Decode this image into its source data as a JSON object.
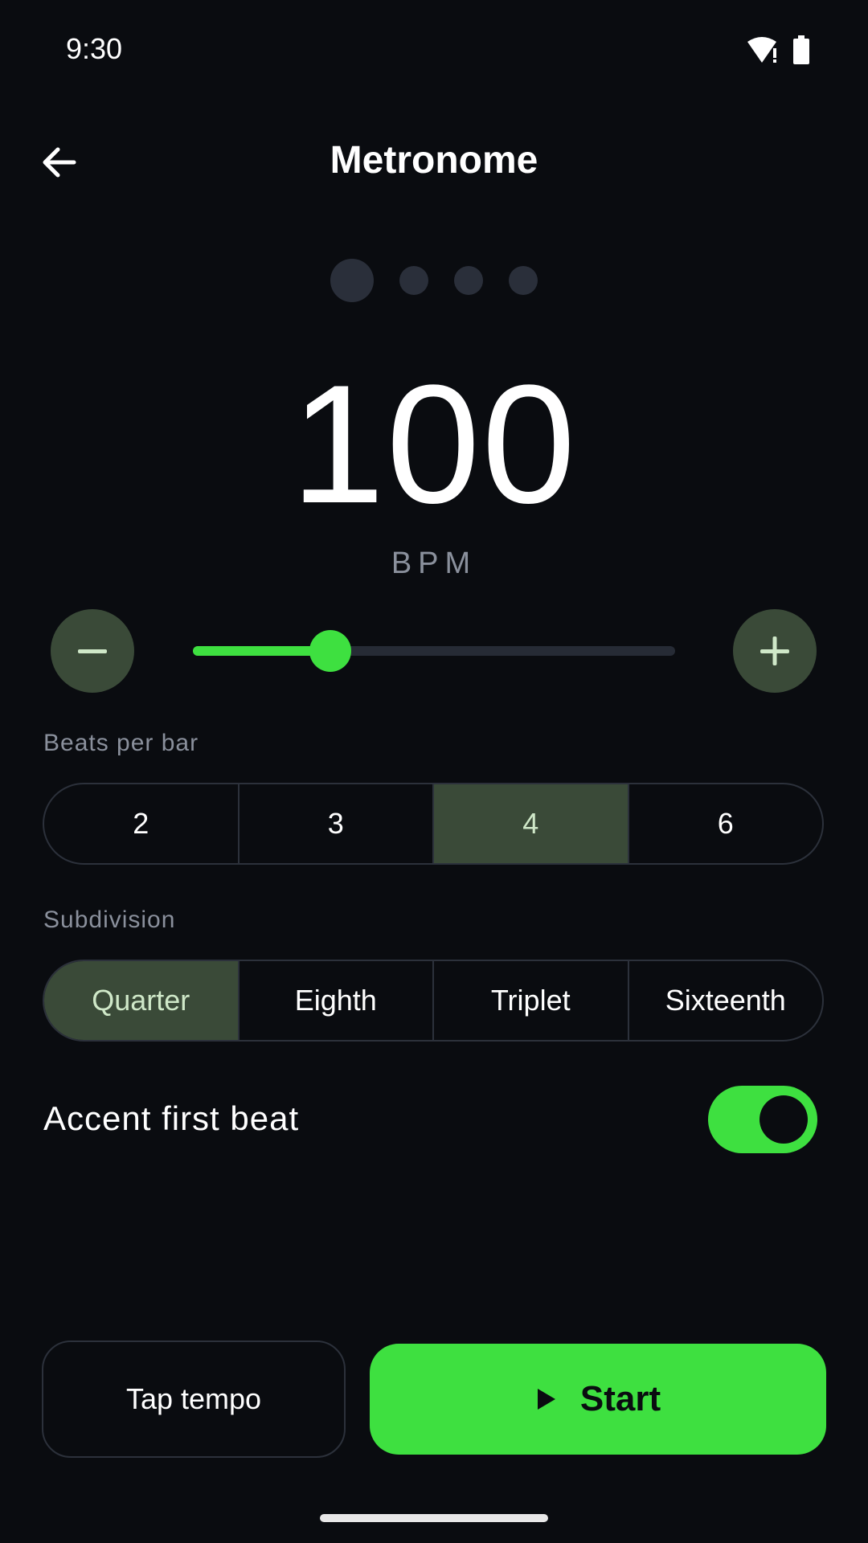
{
  "status": {
    "time": "9:30"
  },
  "header": {
    "title": "Metronome"
  },
  "beats": {
    "count": 4,
    "current": 1
  },
  "tempo": {
    "bpm": "100",
    "unit": "BPM",
    "slider_fraction": 0.285
  },
  "beats_per_bar": {
    "label": "Beats per bar",
    "options": [
      "2",
      "3",
      "4",
      "6"
    ],
    "selected": "4"
  },
  "subdivision": {
    "label": "Subdivision",
    "options": [
      "Quarter",
      "Eighth",
      "Triplet",
      "Sixteenth"
    ],
    "selected": "Quarter"
  },
  "accent": {
    "label": "Accent first beat",
    "enabled": true
  },
  "actions": {
    "tap_label": "Tap tempo",
    "start_label": "Start"
  },
  "colors": {
    "accent": "#3ee040",
    "selected_bg": "#3a4a38",
    "background": "#0a0c10"
  }
}
